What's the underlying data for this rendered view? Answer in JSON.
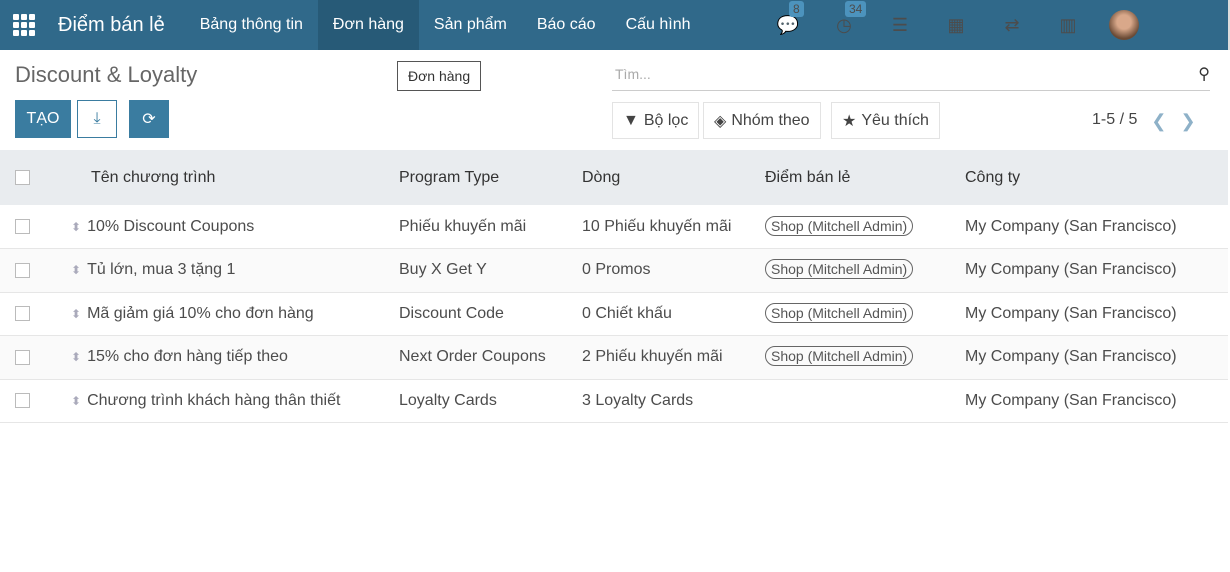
{
  "navbar": {
    "brand": "Điểm bán lẻ",
    "menus": [
      "Bảng thông tin",
      "Đơn hàng",
      "Sản phẩm",
      "Báo cáo",
      "Cấu hình"
    ],
    "active": "Đơn hàng",
    "messages_count": "8",
    "activities_count": "34"
  },
  "page": {
    "title": "Discount & Loyalty",
    "breadcrumb_tooltip": "Đơn hàng",
    "create_label": "TẠO"
  },
  "search": {
    "placeholder": "Tìm..."
  },
  "filters": {
    "filter": "Bộ lọc",
    "group": "Nhóm theo",
    "favorites": "Yêu thích"
  },
  "pager": {
    "range": "1-5 / 5"
  },
  "table": {
    "headers": [
      "Tên chương trình",
      "Program Type",
      "Dòng",
      "Điểm bán lẻ",
      "Công ty"
    ],
    "rows": [
      [
        "10% Discount Coupons",
        "Phiếu khuyến mãi",
        "10 Phiếu khuyến mãi",
        "Shop (Mitchell Admin)",
        "My Company (San Francisco)"
      ],
      [
        "Tủ lớn, mua 3 tặng 1",
        "Buy X Get Y",
        "0 Promos",
        "Shop (Mitchell Admin)",
        "My Company (San Francisco)"
      ],
      [
        "Mã giảm giá 10% cho đơn hàng",
        "Discount Code",
        "0 Chiết khấu",
        "Shop (Mitchell Admin)",
        "My Company (San Francisco)"
      ],
      [
        "15% cho đơn hàng tiếp theo",
        "Next Order Coupons",
        "2 Phiếu khuyến mãi",
        "Shop (Mitchell Admin)",
        "My Company (San Francisco)"
      ],
      [
        "Chương trình khách hàng thân thiết",
        "Loyalty Cards",
        "3 Loyalty Cards",
        "",
        "My Company (San Francisco)"
      ]
    ]
  }
}
